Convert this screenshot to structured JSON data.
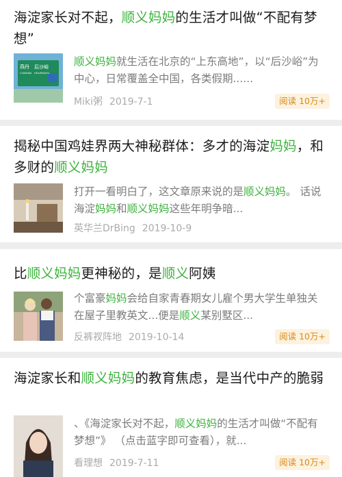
{
  "accent_color": "#3cb33c",
  "articles": [
    {
      "title": [
        {
          "t": "海淀家长对不起，"
        },
        {
          "t": "顺义妈妈",
          "hl": true
        },
        {
          "t": "的生活才叫做“不配有梦想”"
        }
      ],
      "snippet": [
        {
          "t": "顺义妈妈",
          "hl": true
        },
        {
          "t": "就生活在北京的“上东高地”，以“后沙峪”为中心，日常覆盖全中国，各类假期......"
        }
      ],
      "thumb": {
        "icon": "road-sign-image",
        "sign_lines": [
          "燕丹",
          "后沙峪",
          "Y.ANDAN",
          "HOUSHAYU"
        ]
      },
      "author": "Miki粥",
      "date": "2019-7-1",
      "read_label": "阅读",
      "read_count": "10万+"
    },
    {
      "title": [
        {
          "t": "揭秘中国鸡娃界两大神秘群体：多才的海淀"
        },
        {
          "t": "妈妈",
          "hl": true
        },
        {
          "t": "，和多财的"
        },
        {
          "t": "顺义妈妈",
          "hl": true
        }
      ],
      "snippet": [
        {
          "t": "打开一看明白了，这文章原来说的是"
        },
        {
          "t": "顺义妈妈",
          "hl": true
        },
        {
          "t": "。 话说海淀"
        },
        {
          "t": "妈妈",
          "hl": true
        },
        {
          "t": "和"
        },
        {
          "t": "顺义妈妈",
          "hl": true
        },
        {
          "t": "这些年明争暗..."
        }
      ],
      "thumb": {
        "icon": "dining-room-image"
      },
      "author": "英华兰DrBing",
      "date": "2019-10-9"
    },
    {
      "title": [
        {
          "t": "比"
        },
        {
          "t": "顺义妈妈",
          "hl": true
        },
        {
          "t": "更神秘的，是"
        },
        {
          "t": "顺义",
          "hl": true
        },
        {
          "t": "阿姨"
        }
      ],
      "snippet": [
        {
          "t": "个富豪"
        },
        {
          "t": "妈妈",
          "hl": true
        },
        {
          "t": "会给自家青春期女儿雇个男大学生单独关在屋子里教英文...便是"
        },
        {
          "t": "顺义",
          "hl": true
        },
        {
          "t": "某别墅区..."
        }
      ],
      "thumb": {
        "icon": "two-women-image"
      },
      "author": "反裤衩阵地",
      "date": "2019-10-14",
      "read_label": "阅读",
      "read_count": "10万+"
    },
    {
      "title": [
        {
          "t": "海淀家长和"
        },
        {
          "t": "顺义妈妈",
          "hl": true
        },
        {
          "t": "的教育焦虑，是当代中产的脆弱"
        }
      ],
      "snippet": [
        {
          "t": "、《海淀家长对不起，"
        },
        {
          "t": "顺义妈妈",
          "hl": true
        },
        {
          "t": "的生活才叫做“不配有梦想”》 （点击蓝字即可查看），就..."
        }
      ],
      "thumb": {
        "icon": "woman-portrait-image"
      },
      "author": "看理想",
      "date": "2019-7-11",
      "read_label": "阅读",
      "read_count": "10万+"
    }
  ]
}
